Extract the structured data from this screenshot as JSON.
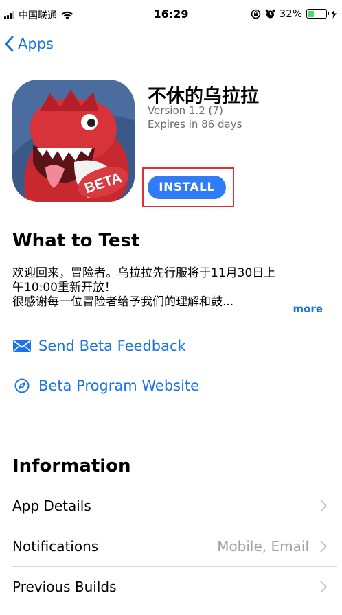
{
  "status_bar": {
    "carrier": "中国联通",
    "time": "16:29",
    "battery": "32%",
    "battery_level": 0.32
  },
  "nav": {
    "back_label": "Apps"
  },
  "app": {
    "title": "不休的乌拉拉",
    "version": "Version 1.2 (7)",
    "expires": "Expires in 86 days",
    "badge": "BETA",
    "install_label": "INSTALL"
  },
  "what_to_test": {
    "heading": "What to Test",
    "lines": [
      "欢迎回来，冒险者。乌拉拉先行服将于11月30日上",
      "午10:00重新开放！",
      "很感谢每一位冒险者给予我们的理解和鼓..."
    ],
    "more_label": "more"
  },
  "links": {
    "feedback": "Send Beta Feedback",
    "website": "Beta Program Website"
  },
  "information": {
    "heading": "Information",
    "rows": [
      {
        "label": "App Details",
        "value": ""
      },
      {
        "label": "Notifications",
        "value": "Mobile, Email"
      },
      {
        "label": "Previous Builds",
        "value": ""
      }
    ]
  },
  "colors": {
    "accent": "#2f7cf6",
    "link": "#1a73e8",
    "highlight_box": "#e0312f",
    "battery_fill": "#4cd964"
  }
}
